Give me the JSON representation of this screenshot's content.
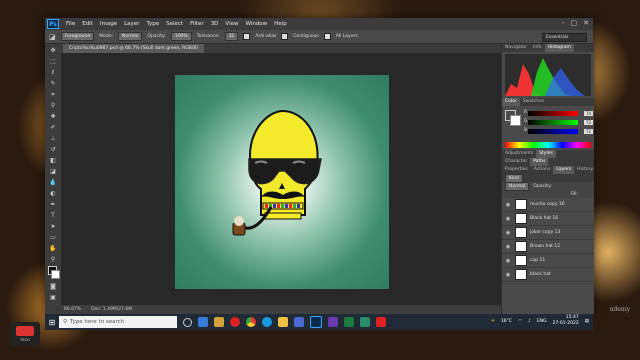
{
  "app": {
    "logo": "Ps"
  },
  "menu": [
    "File",
    "Edit",
    "Image",
    "Layer",
    "Type",
    "Select",
    "Filter",
    "3D",
    "View",
    "Window",
    "Help"
  ],
  "window_controls": [
    "-",
    "▢",
    "✕"
  ],
  "options": {
    "sample_size": "Foreground",
    "mode_label": "Mode:",
    "mode": "Normal",
    "opacity_label": "Opacity:",
    "opacity": "100%",
    "tolerance_label": "Tolerance:",
    "tolerance": "32",
    "anti_alias": "Anti-alias",
    "contiguous": "Contiguous",
    "all_layers": "All Layers",
    "workspace": "Essentials"
  },
  "document_tab": "Cripto%u%u0987.psd @ 66.7% (Skull dark green, RGB/8)",
  "status": {
    "zoom": "66.67%",
    "doc": "Doc: 1.49M/27.6M"
  },
  "panels": {
    "top_tabs": [
      "Navigator",
      "Info",
      "Histogram"
    ],
    "color_tabs": [
      "Color",
      "Swatches"
    ],
    "color_channels": [
      {
        "label": "R",
        "value": "74"
      },
      {
        "label": "G",
        "value": "72"
      },
      {
        "label": "B",
        "value": "72"
      }
    ],
    "adj_tabs": [
      "Adjustments",
      "Styles"
    ],
    "char_tabs": [
      "Character",
      "Paths"
    ],
    "layer_tabs": [
      "Properties",
      "Actions",
      "Layers",
      "History"
    ],
    "kind": "Kind",
    "blend": "Normal",
    "opacity_label": "Opacity:",
    "fill_label": "Fill:",
    "layers": [
      {
        "name": "mucha copy 16"
      },
      {
        "name": "Black hat 16"
      },
      {
        "name": "joker copy 13"
      },
      {
        "name": "Brown hat 12"
      },
      {
        "name": "cap 11"
      },
      {
        "name": "black hat"
      }
    ]
  },
  "taskbar": {
    "search_placeholder": "Type here to search",
    "temperature": "16°C",
    "lang": "ENG",
    "time": "15:47",
    "date": "27-01-2022"
  },
  "branding": {
    "logo_text": "TECH"
  },
  "watermark": "udemy"
}
